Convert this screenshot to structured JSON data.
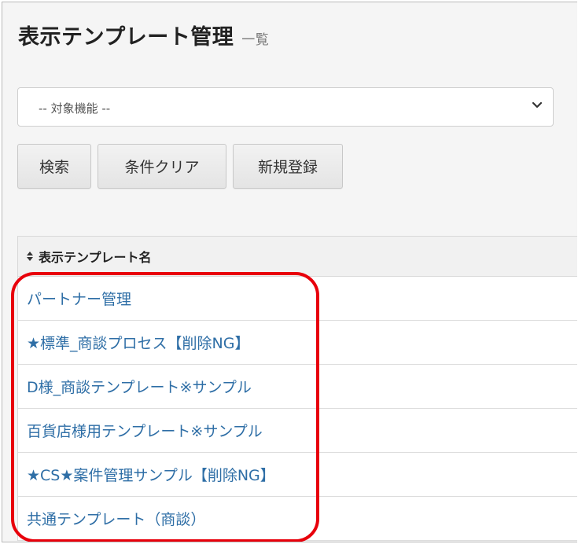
{
  "header": {
    "title": "表示テンプレート管理",
    "subtitle": "一覧"
  },
  "filter": {
    "select_value": "-- 対象機能 --"
  },
  "buttons": {
    "search": "検索",
    "clear": "条件クリア",
    "new": "新規登録"
  },
  "table": {
    "column_header": "表示テンプレート名",
    "rows": [
      "パートナー管理",
      "★標準_商談プロセス【削除NG】",
      "D様_商談テンプレート※サンプル",
      "百貨店様用テンプレート※サンプル",
      "★CS★案件管理サンプル【削除NG】",
      "共通テンプレート（商談）"
    ]
  },
  "colors": {
    "link": "#2e6ea6",
    "highlight": "#e8000b",
    "background": "#f5f5f5"
  },
  "icons": {
    "select": "chevron-down-icon",
    "sort": "sort-icon"
  }
}
